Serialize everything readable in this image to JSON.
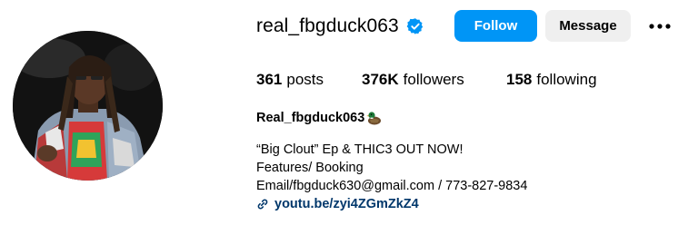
{
  "profile": {
    "username": "real_fbgduck063",
    "follow_label": "Follow",
    "message_label": "Message",
    "stats": {
      "posts_count": "361",
      "posts_label": "posts",
      "followers_count": "376K",
      "followers_label": "followers",
      "following_count": "158",
      "following_label": "following"
    },
    "full_name": "Real_fbgduck063",
    "bio_lines": [
      "“Big Clout” Ep & THIC3 OUT NOW!",
      "Features/ Booking",
      "Email/fbgduck630@gmail.com / 773-827-9834"
    ],
    "link_text": "youtu.be/zyi4ZGmZkZ4"
  },
  "icons": {
    "verified": "verified-badge-icon",
    "more": "more-options-icon",
    "link": "link-icon",
    "duck": "duck-emoji-icon"
  },
  "colors": {
    "follow_bg": "#0095f6",
    "message_bg": "#efefef",
    "verified": "#0095f6",
    "link": "#00376b"
  }
}
